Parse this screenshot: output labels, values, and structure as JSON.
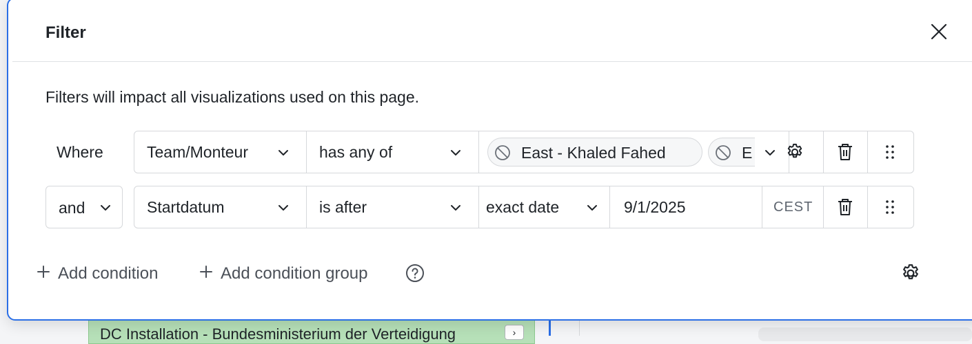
{
  "dialog": {
    "title": "Filter",
    "description": "Filters will impact all visualizations used on this page."
  },
  "conditions": [
    {
      "connector": "Where",
      "field": "Team/Monteur",
      "operator": "has any of",
      "values": [
        "East - Khaled Fahed",
        "E"
      ]
    },
    {
      "connector": "and",
      "field": "Startdatum",
      "operator": "is after",
      "date_mode": "exact date",
      "date_value": "9/1/2025",
      "timezone": "CEST"
    }
  ],
  "footer": {
    "add_condition": "Add condition",
    "add_condition_group": "Add condition group"
  },
  "background": {
    "task_label": "DC Installation - Bundesministerium der Verteidigung"
  },
  "colors": {
    "accent": "#2a6ee6",
    "border": "#d6d8db",
    "task_fill": "#b6e0b8"
  }
}
